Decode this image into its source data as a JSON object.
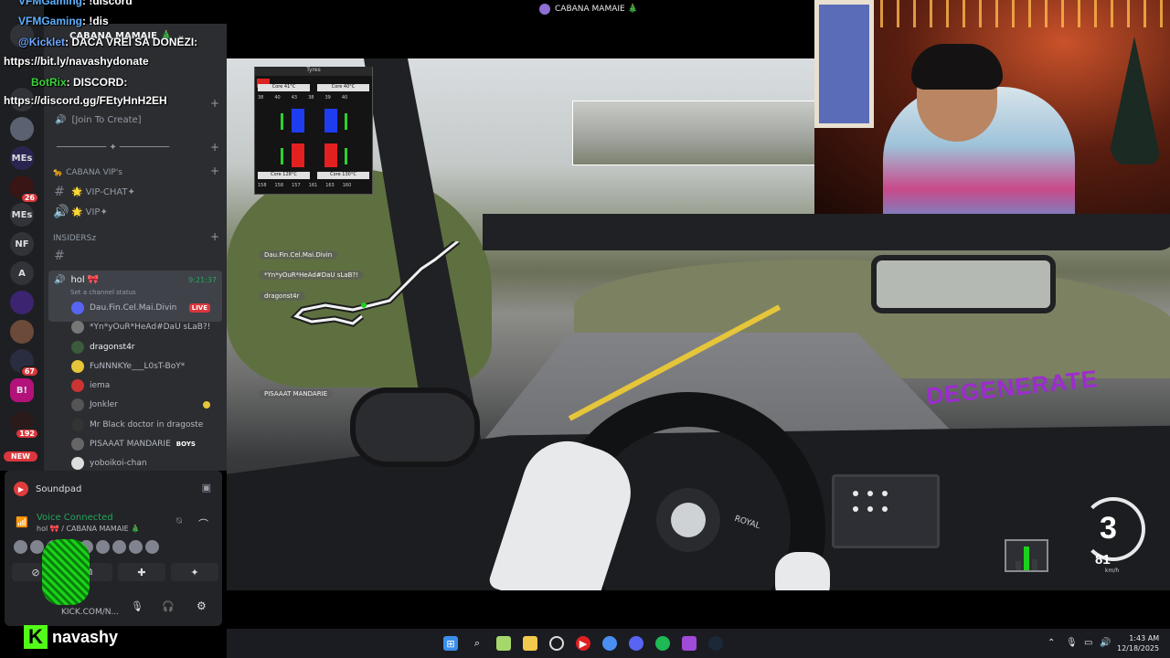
{
  "top_title": "CABANA MAMAIE 🎄",
  "chat": [
    {
      "user": "VFMGaming",
      "text": ": !discord"
    },
    {
      "user": "VFMGaming",
      "text": ": !dis"
    },
    {
      "user": "@Kicklet",
      "text": ": DACA VREI SA DONEZI:"
    },
    {
      "user": "",
      "text": "https://bit.ly/navashydonate"
    },
    {
      "user": "BotRix",
      "text": ": DISCORD:"
    },
    {
      "user": "",
      "text": "https://discord.gg/FEtyHnH2EH"
    }
  ],
  "server": {
    "name": "CABANA MAMAIE 🎄",
    "rail_items": [
      {
        "label": "",
        "badge": ""
      },
      {
        "label": "",
        "badge": ""
      },
      {
        "label": "",
        "badge": "26"
      },
      {
        "label": "MEs",
        "badge": ""
      },
      {
        "label": "NF",
        "badge": ""
      },
      {
        "label": "A",
        "badge": ""
      },
      {
        "label": "",
        "badge": ""
      },
      {
        "label": "",
        "badge": ""
      },
      {
        "label": "",
        "badge": "67"
      },
      {
        "label": "B!",
        "badge": ""
      },
      {
        "label": "",
        "badge": "192"
      }
    ],
    "new_label": "NEW"
  },
  "channels": {
    "join_to_create": "[Join To Create]",
    "divider": "───────── ✦ ─────────",
    "cat_vip": "🐆 CABANA VIP's",
    "vip_chat": "🌟 VIP-CHAT✦",
    "vip": "🌟 VIP✦",
    "cat_insiders": "INSIDERSz",
    "active_voice": "hol 🎀",
    "active_time": "9:21:37",
    "active_status": "Set a channel status",
    "members": [
      {
        "name": "Dau.Fin.Cel.Mai.Divin",
        "tag": "LIVE"
      },
      {
        "name": "*Yn*yOuR*HeAd#DaU sLaB?!",
        "tag": ""
      },
      {
        "name": "dragonst4r",
        "tag": ""
      },
      {
        "name": "FuNNNKYe___L0sT-BoY*",
        "tag": ""
      },
      {
        "name": "iema",
        "tag": ""
      },
      {
        "name": "Jonkler",
        "tag": ""
      },
      {
        "name": "Mr Black doctor in dragoste",
        "tag": ""
      },
      {
        "name": "PISAAAT MANDARIE",
        "tag": "BOYS"
      },
      {
        "name": "yoboikoi-chan",
        "tag": ""
      }
    ]
  },
  "panel": {
    "soundpad": "Soundpad",
    "voice_connected": "Voice Connected",
    "voice_channel": "hol 🎀 / CABANA MAMAIE 🎄",
    "user_status": "KICK.COM/N..."
  },
  "kick": {
    "logo": "K",
    "username": "navashy"
  },
  "game": {
    "tyres_title": "Tyres",
    "tyres": {
      "core_fl": "Core 41°C",
      "core_fr": "Core 40°C",
      "core_rl": "Core 128°C",
      "core_rr": "Core 130°C",
      "front_vals": [
        "38",
        "40",
        "43",
        "38",
        "39",
        "40"
      ],
      "rear_vals": [
        "158",
        "158",
        "157",
        "161",
        "163",
        "160"
      ]
    },
    "gear": "3",
    "speed": "81",
    "speed_unit": "km/h",
    "race_list": [
      "Dau.Fin.Cel.Mai.Divin",
      "*Yn*yOuR*HeAd#DaU sLaB?!",
      "dragonst4r",
      "PISAAAT MANDARIE"
    ],
    "livery_text": "DEGENERATE",
    "steering_brand": "ROYAL",
    "colors": {
      "tyre_cold": "#1f3df0",
      "tyre_hot": "#e32020",
      "pedal": "#1bd11b"
    }
  },
  "taskbar": {
    "icons": [
      "windows-icon",
      "search-icon",
      "notepad-icon",
      "file-explorer-icon",
      "obs-icon",
      "youtube-icon",
      "chrome-icon",
      "discord-icon",
      "spotify-icon",
      "game-icon",
      "steam-icon"
    ],
    "time": "1:43 AM",
    "date": "12/18/2025"
  }
}
